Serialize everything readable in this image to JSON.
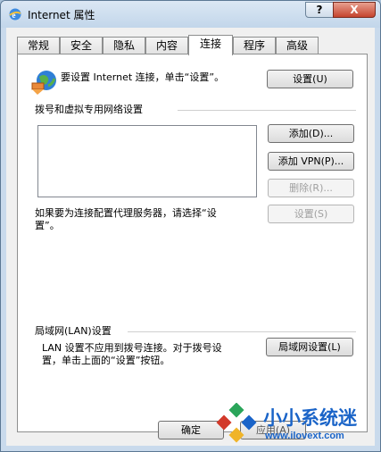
{
  "window": {
    "title": "Internet 属性",
    "help_label": "?",
    "close_label": "X"
  },
  "tabs": [
    {
      "label": "常规"
    },
    {
      "label": "安全"
    },
    {
      "label": "隐私"
    },
    {
      "label": "内容"
    },
    {
      "label": "连接",
      "active": true
    },
    {
      "label": "程序"
    },
    {
      "label": "高级"
    }
  ],
  "connection": {
    "setup_text": "要设置 Internet 连接，单击“设置”。",
    "setup_button": "设置(U)",
    "dialup_header": "拨号和虚拟专用网络设置",
    "add_button": "添加(D)...",
    "add_vpn_button": "添加 VPN(P)...",
    "delete_button": "删除(R)...",
    "proxy_text_1": "如果要为连接配置代理服务器，请选择“设",
    "proxy_text_2": "置”。",
    "settings_button": "设置(S)",
    "lan_header": "局域网(LAN)设置",
    "lan_text_1": "LAN 设置不应用到拨号连接。对于拨号设",
    "lan_text_2": "置，单击上面的“设置”按钮。",
    "lan_button": "局域网设置(L)"
  },
  "footer": {
    "ok_button": "确定",
    "partial_label": "应用(A)"
  },
  "watermark": {
    "brand": "小小系统迷",
    "url": "www.ilovext.com"
  },
  "colors": {
    "titlebar": "#c9daec",
    "watermark_blue": "#1a64c8",
    "watermark_red": "#d23a2a",
    "watermark_green": "#2aa55a"
  }
}
